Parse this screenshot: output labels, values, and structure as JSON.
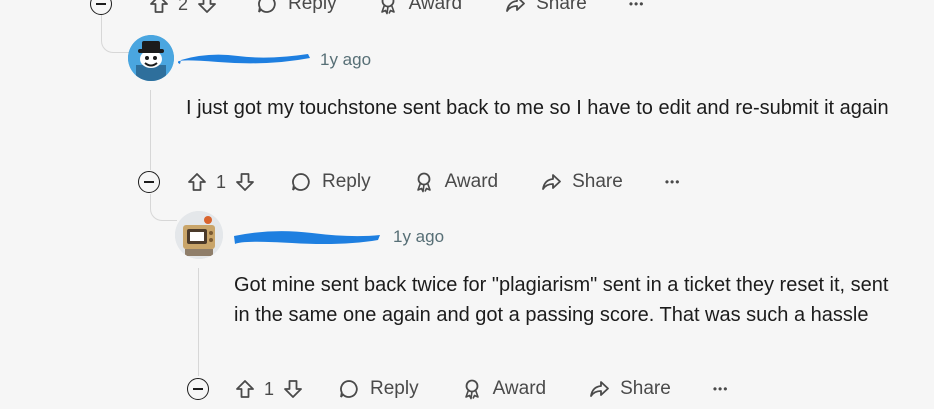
{
  "top_actions": {
    "vote_count": "2",
    "reply_label": "Reply",
    "award_label": "Award",
    "share_label": "Share",
    "more_label": "•••"
  },
  "comments": [
    {
      "timestamp": "1y ago",
      "body": "I just got my touchstone sent back to me so I have to edit and re-submit it again",
      "vote_count": "1",
      "reply_label": "Reply",
      "award_label": "Award",
      "share_label": "Share",
      "more_label": "•••"
    },
    {
      "timestamp": "1y ago",
      "body": "Got mine sent back twice for \"plagiarism\" sent in a ticket they reset it, sent in the same one again and got a passing score. That was such a hassle",
      "vote_count": "1",
      "reply_label": "Reply",
      "award_label": "Award",
      "share_label": "Share",
      "more_label": "•••"
    }
  ],
  "colors": {
    "background": "#f6f6f6",
    "redaction": "#1e7fe0",
    "thread_line": "#d7d7d7"
  }
}
